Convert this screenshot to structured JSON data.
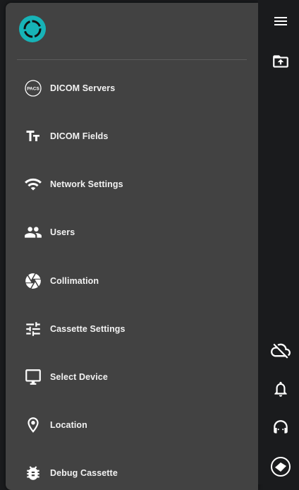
{
  "menu": {
    "items": [
      {
        "label": "DICOM Servers",
        "icon": "pacs-icon"
      },
      {
        "label": "DICOM Fields",
        "icon": "text-fields-icon"
      },
      {
        "label": "Network Settings",
        "icon": "wifi-icon"
      },
      {
        "label": "Users",
        "icon": "users-icon"
      },
      {
        "label": "Collimation",
        "icon": "aperture-icon"
      },
      {
        "label": "Cassette Settings",
        "icon": "tune-icon"
      },
      {
        "label": "Select Device",
        "icon": "monitor-icon"
      },
      {
        "label": "Location",
        "icon": "location-pin-icon"
      },
      {
        "label": "Debug Cassette",
        "icon": "bug-icon"
      }
    ],
    "pacs_badge": "PACS"
  },
  "rail": {
    "icons": [
      "menu-icon",
      "folder-upload-icon",
      "cloud-off-icon",
      "bell-icon",
      "support-icon",
      "device-status-icon"
    ]
  },
  "colors": {
    "drawer_bg": "#424242",
    "rail_bg": "#1a1b1d",
    "brand": "#17b3b7",
    "text": "#f2f2f2"
  }
}
